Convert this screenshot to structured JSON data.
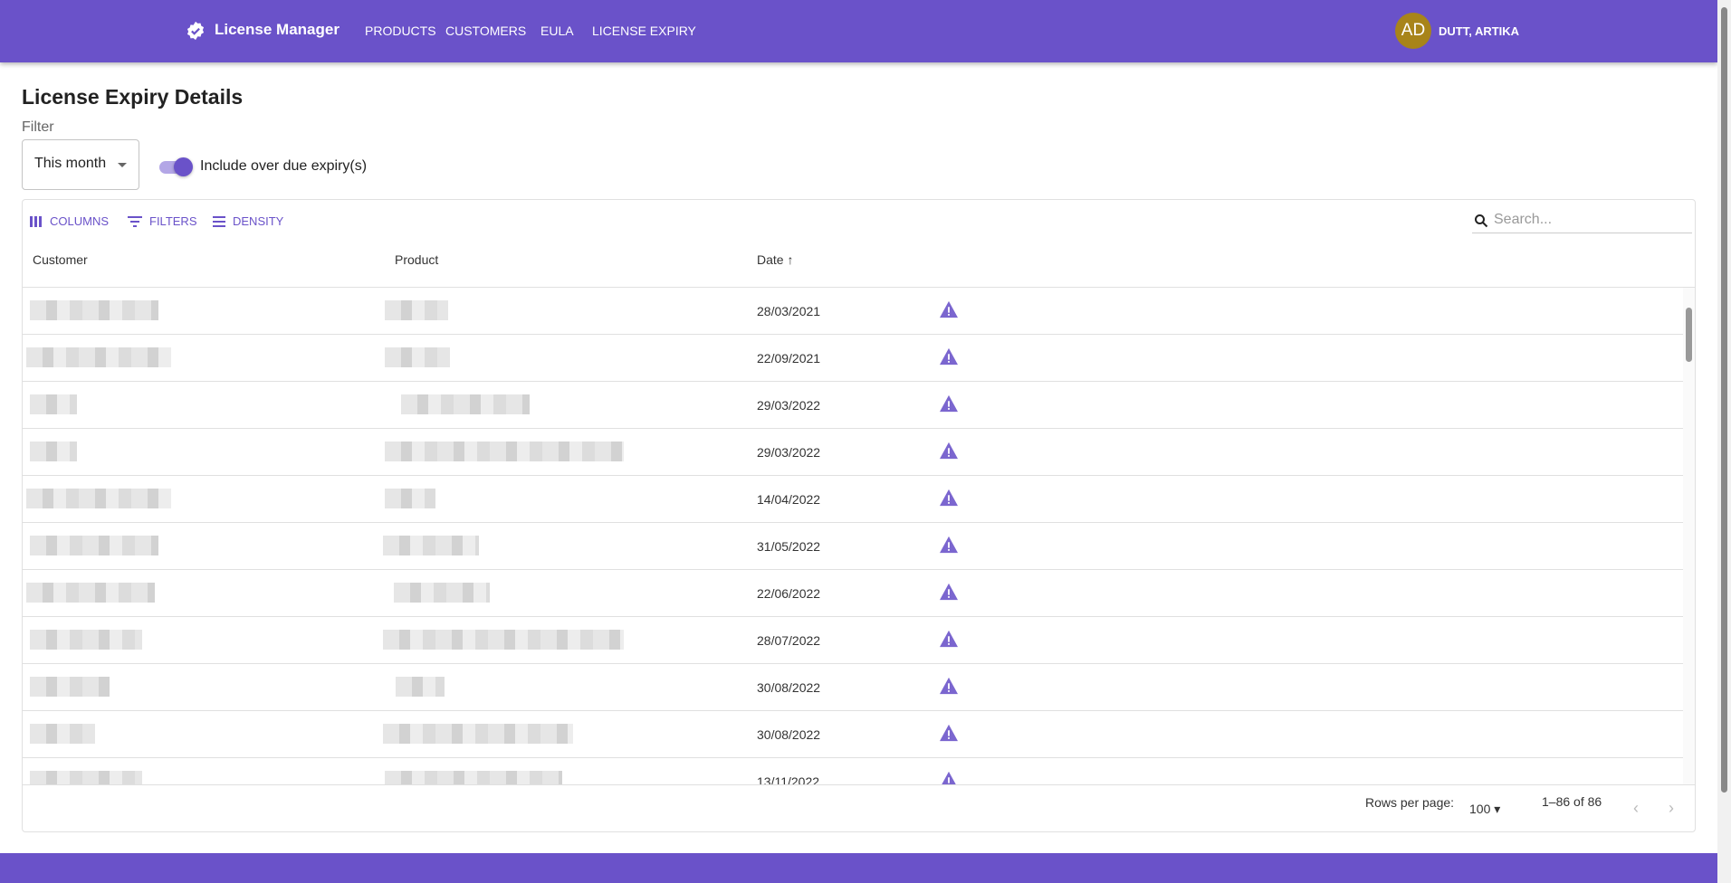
{
  "app": {
    "title": "License Manager",
    "logo_icon": "verified-badge-icon",
    "accent": "#6a52c9"
  },
  "nav": [
    "PRODUCTS",
    "CUSTOMERS",
    "EULA",
    "LICENSE EXPIRY"
  ],
  "user": {
    "initials": "AD",
    "name": "DUTT, ARTIKA",
    "avatar_color": "#a8841a"
  },
  "page": {
    "title": "License Expiry Details",
    "filter_label": "Filter",
    "filter_value": "This month",
    "toggle_label": "Include over due expiry(s)",
    "toggle_on": true
  },
  "toolbar": {
    "columns": "COLUMNS",
    "filters": "FILTERS",
    "density": "DENSITY",
    "search_placeholder": "Search..."
  },
  "columns": [
    "Customer",
    "Product",
    "Date"
  ],
  "sort": {
    "column": "Date",
    "direction": "ascending"
  },
  "rows": [
    {
      "date": "28/03/2021"
    },
    {
      "date": "22/09/2021"
    },
    {
      "date": "29/03/2022"
    },
    {
      "date": "29/03/2022"
    },
    {
      "date": "14/04/2022"
    },
    {
      "date": "31/05/2022"
    },
    {
      "date": "22/06/2022"
    },
    {
      "date": "28/07/2022"
    },
    {
      "date": "30/08/2022"
    },
    {
      "date": "30/08/2022"
    },
    {
      "date": "13/11/2022"
    }
  ],
  "footer": {
    "rows_per_page_label": "Rows per page:",
    "rows_per_page": "100",
    "range": "1–86 of 86"
  }
}
